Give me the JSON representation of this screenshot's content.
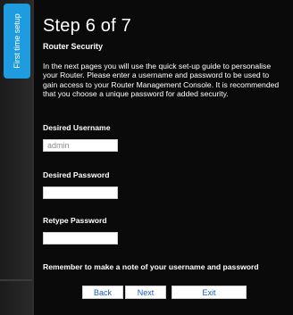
{
  "sidebar": {
    "tab_label": "First time setup"
  },
  "wizard": {
    "step_title": "Step 6 of 7",
    "section_heading": "Router Security",
    "intro_text": "In the next pages you will use the quick set-up guide to personalise your Router. Please enter a username and password to be used to gain access to your Router Management Console. It is recommended that you choose a unique password for added security."
  },
  "form": {
    "username_label": "Desired Username",
    "username_value": "admin",
    "password_label": "Desired Password",
    "password_value": "",
    "retype_label": "Retype Password",
    "retype_value": ""
  },
  "reminder": "Remember to make a note of your username and password",
  "buttons": {
    "back": "Back",
    "next": "Next",
    "exit": "Exit"
  }
}
